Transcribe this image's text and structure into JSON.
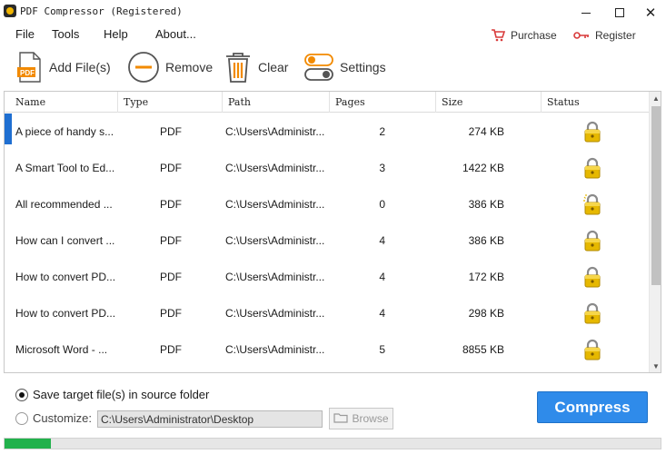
{
  "window": {
    "title": "PDF Compressor (Registered)",
    "icons": [
      "app-icon",
      "minimize-icon",
      "maximize-icon",
      "close-icon"
    ]
  },
  "menu": {
    "items": [
      "File",
      "Tools",
      "Help",
      "About..."
    ],
    "purchase_label": "Purchase",
    "register_label": "Register"
  },
  "toolbar": {
    "add_label": "Add File(s)",
    "remove_label": "Remove",
    "clear_label": "Clear",
    "settings_label": "Settings",
    "icons": [
      "pdf-file-icon",
      "remove-circle-icon",
      "trash-icon",
      "settings-toggle-icon"
    ]
  },
  "table": {
    "columns": [
      "Name",
      "Type",
      "Path",
      "Pages",
      "Size",
      "Status"
    ],
    "rows": [
      {
        "name": "A piece of handy s...",
        "type": "PDF",
        "path": "C:\\Users\\Administr...",
        "pages": "2",
        "size": "274 KB",
        "status": "lock-icon"
      },
      {
        "name": "A Smart Tool to Ed...",
        "type": "PDF",
        "path": "C:\\Users\\Administr...",
        "pages": "3",
        "size": "1422 KB",
        "status": "lock-icon"
      },
      {
        "name": "All recommended ...",
        "type": "PDF",
        "path": "C:\\Users\\Administr...",
        "pages": "0",
        "size": "386 KB",
        "status": "lock-sparkle-icon"
      },
      {
        "name": "How can I convert ...",
        "type": "PDF",
        "path": "C:\\Users\\Administr...",
        "pages": "4",
        "size": "386 KB",
        "status": "lock-icon"
      },
      {
        "name": "How to convert PD...",
        "type": "PDF",
        "path": "C:\\Users\\Administr...",
        "pages": "4",
        "size": "172 KB",
        "status": "lock-icon"
      },
      {
        "name": "How to convert PD...",
        "type": "PDF",
        "path": "C:\\Users\\Administr...",
        "pages": "4",
        "size": "298 KB",
        "status": "lock-icon"
      },
      {
        "name": "Microsoft Word - ...",
        "type": "PDF",
        "path": "C:\\Users\\Administr...",
        "pages": "5",
        "size": "8855 KB",
        "status": "lock-icon"
      }
    ]
  },
  "output": {
    "save_source_label": "Save target file(s) in source folder",
    "save_source_selected": true,
    "customize_label": "Customize:",
    "customize_selected": false,
    "custom_path": "C:\\Users\\Administrator\\Desktop",
    "browse_label": "Browse",
    "compress_label": "Compress"
  },
  "progress": {
    "fraction": 0.07,
    "color": "#22b14c"
  },
  "colors": {
    "accent": "#2f8bea",
    "toolbar_orange": "#f28a00",
    "lock_gold": "#e6b800",
    "purchase_red": "#d83a3a"
  }
}
